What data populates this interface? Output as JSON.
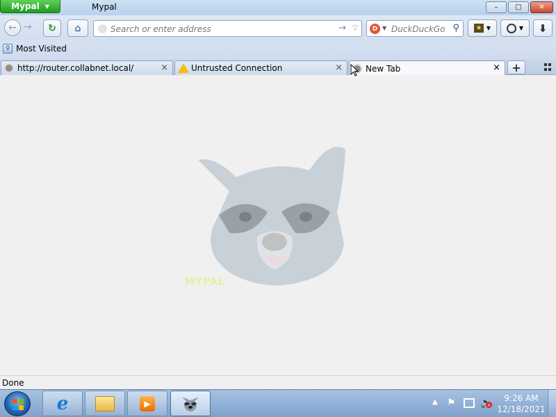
{
  "window": {
    "app_button_label": "Mypal",
    "title": "Mypal",
    "controls": {
      "minimize": "–",
      "maximize": "□",
      "close": "✕"
    }
  },
  "toolbar": {
    "url_placeholder": "Search or enter address",
    "search_engine": "DuckDuckGo",
    "search_placeholder": "DuckDuckGo"
  },
  "bookmarks": {
    "items": [
      {
        "label": "Most Visited",
        "icon": "most-visited-icon"
      }
    ]
  },
  "tabs": [
    {
      "label": "http://router.collabnet.local/",
      "icon": "globe-icon",
      "active": false
    },
    {
      "label": "Untrusted Connection",
      "icon": "warning-icon",
      "active": false
    },
    {
      "label": "New Tab",
      "icon": "globe-icon",
      "active": true
    }
  ],
  "content": {
    "watermark": "MYPAL"
  },
  "status": {
    "text": "Done"
  },
  "taskbar": {
    "pinned": [
      {
        "name": "internet-explorer-icon"
      },
      {
        "name": "file-explorer-icon"
      },
      {
        "name": "media-player-icon"
      },
      {
        "name": "mypal-icon",
        "active": true
      }
    ],
    "clock": {
      "time": "9:26 AM",
      "date": "12/18/2021"
    }
  },
  "colors": {
    "app_button": "#1f9b1c",
    "close_button": "#c44a32",
    "warning": "#f2c200",
    "taskbar": "#7fa1cb"
  }
}
